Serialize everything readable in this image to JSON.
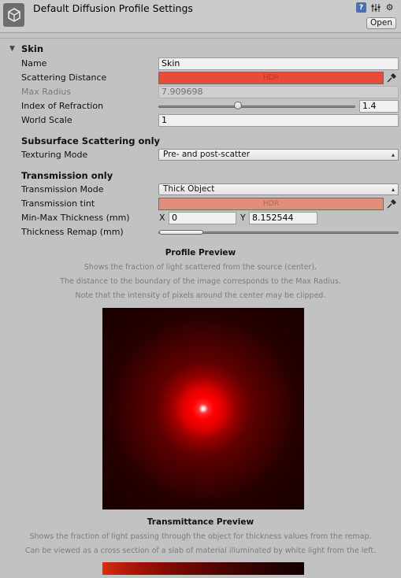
{
  "header": {
    "title": "Default Diffusion Profile Settings",
    "open_label": "Open"
  },
  "section": {
    "title": "Skin"
  },
  "fields": {
    "name_label": "Name",
    "name_value": "Skin",
    "scattering_label": "Scattering Distance",
    "scattering_hdr": "HDR",
    "scattering_color": "#e84b38",
    "max_radius_label": "Max Radius",
    "max_radius_value": "7.909698",
    "ior_label": "Index of Refraction",
    "ior_value": "1.4",
    "world_scale_label": "World Scale",
    "world_scale_value": "1"
  },
  "sss": {
    "heading": "Subsurface Scattering only",
    "texturing_label": "Texturing Mode",
    "texturing_value": "Pre- and post-scatter"
  },
  "transmission": {
    "heading": "Transmission only",
    "mode_label": "Transmission Mode",
    "mode_value": "Thick Object",
    "tint_label": "Transmission tint",
    "tint_hdr": "HDR",
    "tint_color": "#e0907a",
    "minmax_label": "Min-Max Thickness (mm)",
    "x_label": "X",
    "x_value": "0",
    "y_label": "Y",
    "y_value": "8.152544",
    "remap_label": "Thickness Remap (mm)"
  },
  "profile_preview": {
    "title": "Profile Preview",
    "line1": "Shows the fraction of light scattered from the source (center).",
    "line2": "The distance to the boundary of the image corresponds to the Max Radius.",
    "line3": "Note that the intensity of pixels around the center may be clipped."
  },
  "transmittance_preview": {
    "title": "Transmittance Preview",
    "line1": "Shows the fraction of light passing through the object for thickness values from the remap.",
    "line2": "Can be viewed as a cross section of a slab of material illuminated by white light from the left."
  }
}
